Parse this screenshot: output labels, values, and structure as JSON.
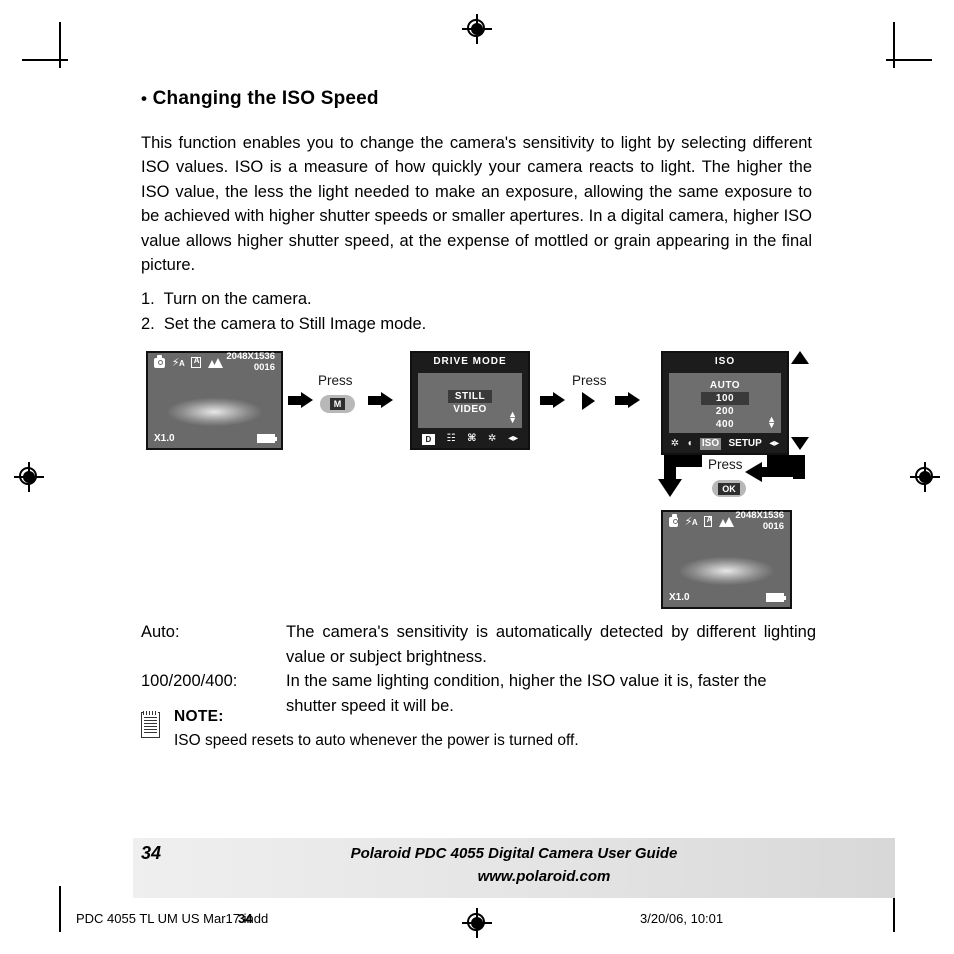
{
  "document": {
    "heading_bullet": "•",
    "heading": "Changing the ISO Speed",
    "paragraph": "This function enables you to change the camera's sensitivity to light by selecting different ISO values. ISO is a measure of how quickly your camera reacts to light. The higher the ISO value, the less the light needed to make an exposure, allowing the same exposure to be achieved with higher shutter speeds or smaller apertures. In a digital camera, higher ISO value allows higher shutter speed, at the expense of mottled or grain appearing in the final picture.",
    "steps": [
      "1.  Turn on the camera.",
      "2.  Set the camera to Still Image mode."
    ]
  },
  "diagram": {
    "screen1": {
      "icons": [
        "camera-icon",
        "flash-auto-icon",
        "white-balance-auto-icon",
        "macro-mountain-icon"
      ],
      "flash_label": "A",
      "wb_label": "A",
      "resolution": "2048X1536",
      "counter": "0016",
      "zoom": "X1.0",
      "battery": "battery-full-icon"
    },
    "press1": {
      "label": "Press",
      "button": "M"
    },
    "drive_mode": {
      "title": "DRIVE MODE",
      "options": [
        "STILL",
        "VIDEO"
      ],
      "selected": "STILL",
      "updown": "updown-arrows-icon",
      "toolbar": [
        "D",
        "drive-mode-icon",
        "exposure-icon",
        "brightness-icon",
        "leftright-arrows-icon"
      ]
    },
    "press2": {
      "label": "Press",
      "button": "right-arrow"
    },
    "iso": {
      "title": "ISO",
      "options": [
        "AUTO",
        "100",
        "200",
        "400"
      ],
      "selected": "100",
      "updown": "updown-arrows-icon",
      "toolbar": [
        "sharpness-icon",
        "contrast-icon",
        "ISO",
        "SETUP",
        "leftright-arrows-icon"
      ],
      "toolbar_selected": "ISO"
    },
    "press3": {
      "label": "Press",
      "button": "OK"
    },
    "screen2": {
      "icons": [
        "camera-icon",
        "flash-auto-icon",
        "white-balance-auto-icon",
        "macro-mountain-icon"
      ],
      "flash_label": "A",
      "wb_label": "A",
      "resolution": "2048X1536",
      "counter": "0016",
      "zoom": "X1.0",
      "battery": "battery-full-icon"
    }
  },
  "definitions": [
    {
      "term": "Auto:",
      "desc": "The camera's sensitivity is automatically detected by different lighting value or subject brightness."
    },
    {
      "term": "100/200/400:",
      "desc": "In the same lighting condition, higher the ISO value it is, faster the shutter speed it will be."
    }
  ],
  "note": {
    "title": "NOTE:",
    "text": "ISO speed resets to auto whenever the power is turned off.",
    "icon": "notepad-icon"
  },
  "footer": {
    "page_number": "34",
    "line1": "Polaroid PDC 4055 Digital Camera User Guide",
    "line2": "www.polaroid.com"
  },
  "print_slug": {
    "left": "PDC 4055 TL UM US Mar17.indd",
    "overlap": "34",
    "right": "3/20/06, 10:01"
  }
}
